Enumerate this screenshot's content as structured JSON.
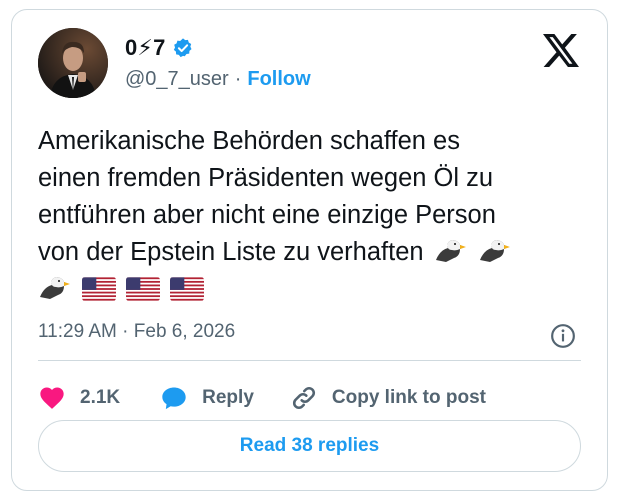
{
  "tweet": {
    "display_name": "0⚡7",
    "handle": "@0_7_user",
    "separator": "·",
    "follow_label": "Follow",
    "text_lines": [
      "Amerikanische Behörden schaffen es",
      "einen fremden Präsidenten wegen Öl zu",
      "entführen aber nicht eine einzige Person",
      "von der Epstein Liste zu verhaften"
    ],
    "time": "11:29 AM",
    "date": "Feb 6, 2026",
    "likes": "2.1K",
    "reply_label": "Reply",
    "copy_link_label": "Copy link to post",
    "read_replies_label": "Read 38 replies"
  },
  "icons": {
    "verified": "verified-badge-icon",
    "brand": "x-logo-icon",
    "like": "heart-icon",
    "reply": "speech-bubble-icon",
    "copy": "link-icon",
    "info": "info-icon",
    "emojis": [
      "eagle-icon",
      "eagle-icon",
      "eagle-icon",
      "us-flag-icon",
      "us-flag-icon",
      "us-flag-icon"
    ]
  },
  "colors": {
    "accent": "#1d9bf0",
    "heart": "#f91880",
    "text": "#0f1419",
    "muted": "#536471",
    "border": "#cfd9de"
  }
}
